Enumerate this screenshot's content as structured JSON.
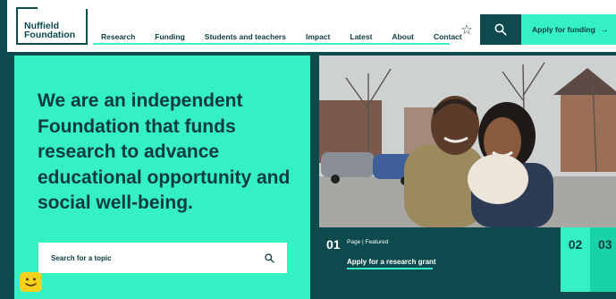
{
  "logo": {
    "line1": "Nuffield",
    "line2": "Foundation"
  },
  "nav": [
    "Research",
    "Funding",
    "Students and teachers",
    "Impact",
    "Latest",
    "About",
    "Contact"
  ],
  "header": {
    "favourite_icon": "star-icon",
    "search_icon": "search-icon",
    "apply_label": "Apply for funding",
    "apply_icon": "arrow-right-icon"
  },
  "hero": {
    "title": "We are an independent Foundation that funds research to advance educational opportunity and social well-being.",
    "search_placeholder": "Search for a topic"
  },
  "feature": {
    "number": "01",
    "kicker": "Page | Featured",
    "link": "Apply for a research grant"
  },
  "slides": {
    "second": "02",
    "third": "03"
  },
  "colors": {
    "mint": "#34f0c2",
    "teal": "#0c4a4d",
    "white": "#ffffff"
  }
}
